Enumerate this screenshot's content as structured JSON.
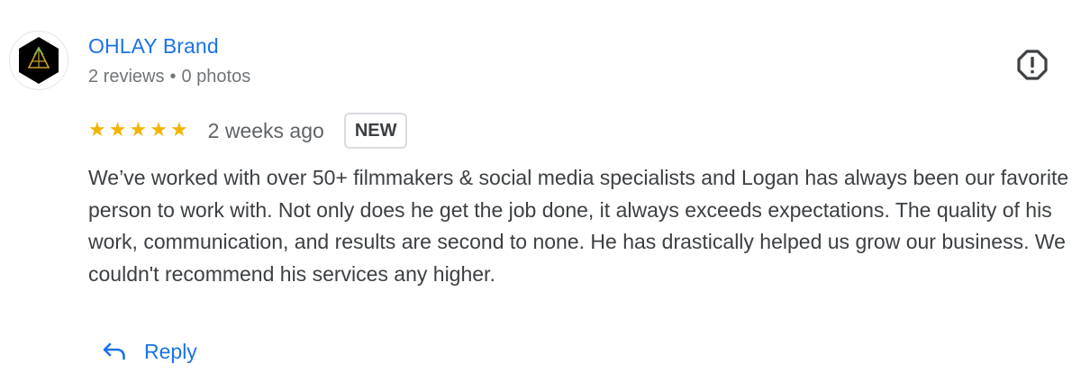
{
  "reviewer": {
    "name": "OHLAY Brand",
    "reviews": "2 reviews",
    "separator": "•",
    "photos": "0 photos",
    "avatar_icon": "hexagon-logo-icon"
  },
  "review": {
    "rating": 5,
    "stars": [
      "★",
      "★",
      "★",
      "★",
      "★"
    ],
    "date": "2 weeks ago",
    "badge": "NEW",
    "text": "We’ve worked with over 50+ filmmakers & social media specialists and Logan has always been our favorite person to work with. Not only does he get the job done, it always exceeds expectations. The quality of his work, communication, and results are second to none. He has drastically helped us grow our business. We couldn't recommend his services any higher."
  },
  "actions": {
    "reply_label": "Reply",
    "reply_icon": "reply-arrow-icon",
    "flag_icon": "report-icon"
  },
  "colors": {
    "link": "#1a73e8",
    "star": "#f4b400",
    "meta": "#70757a",
    "text": "#3c4043"
  }
}
